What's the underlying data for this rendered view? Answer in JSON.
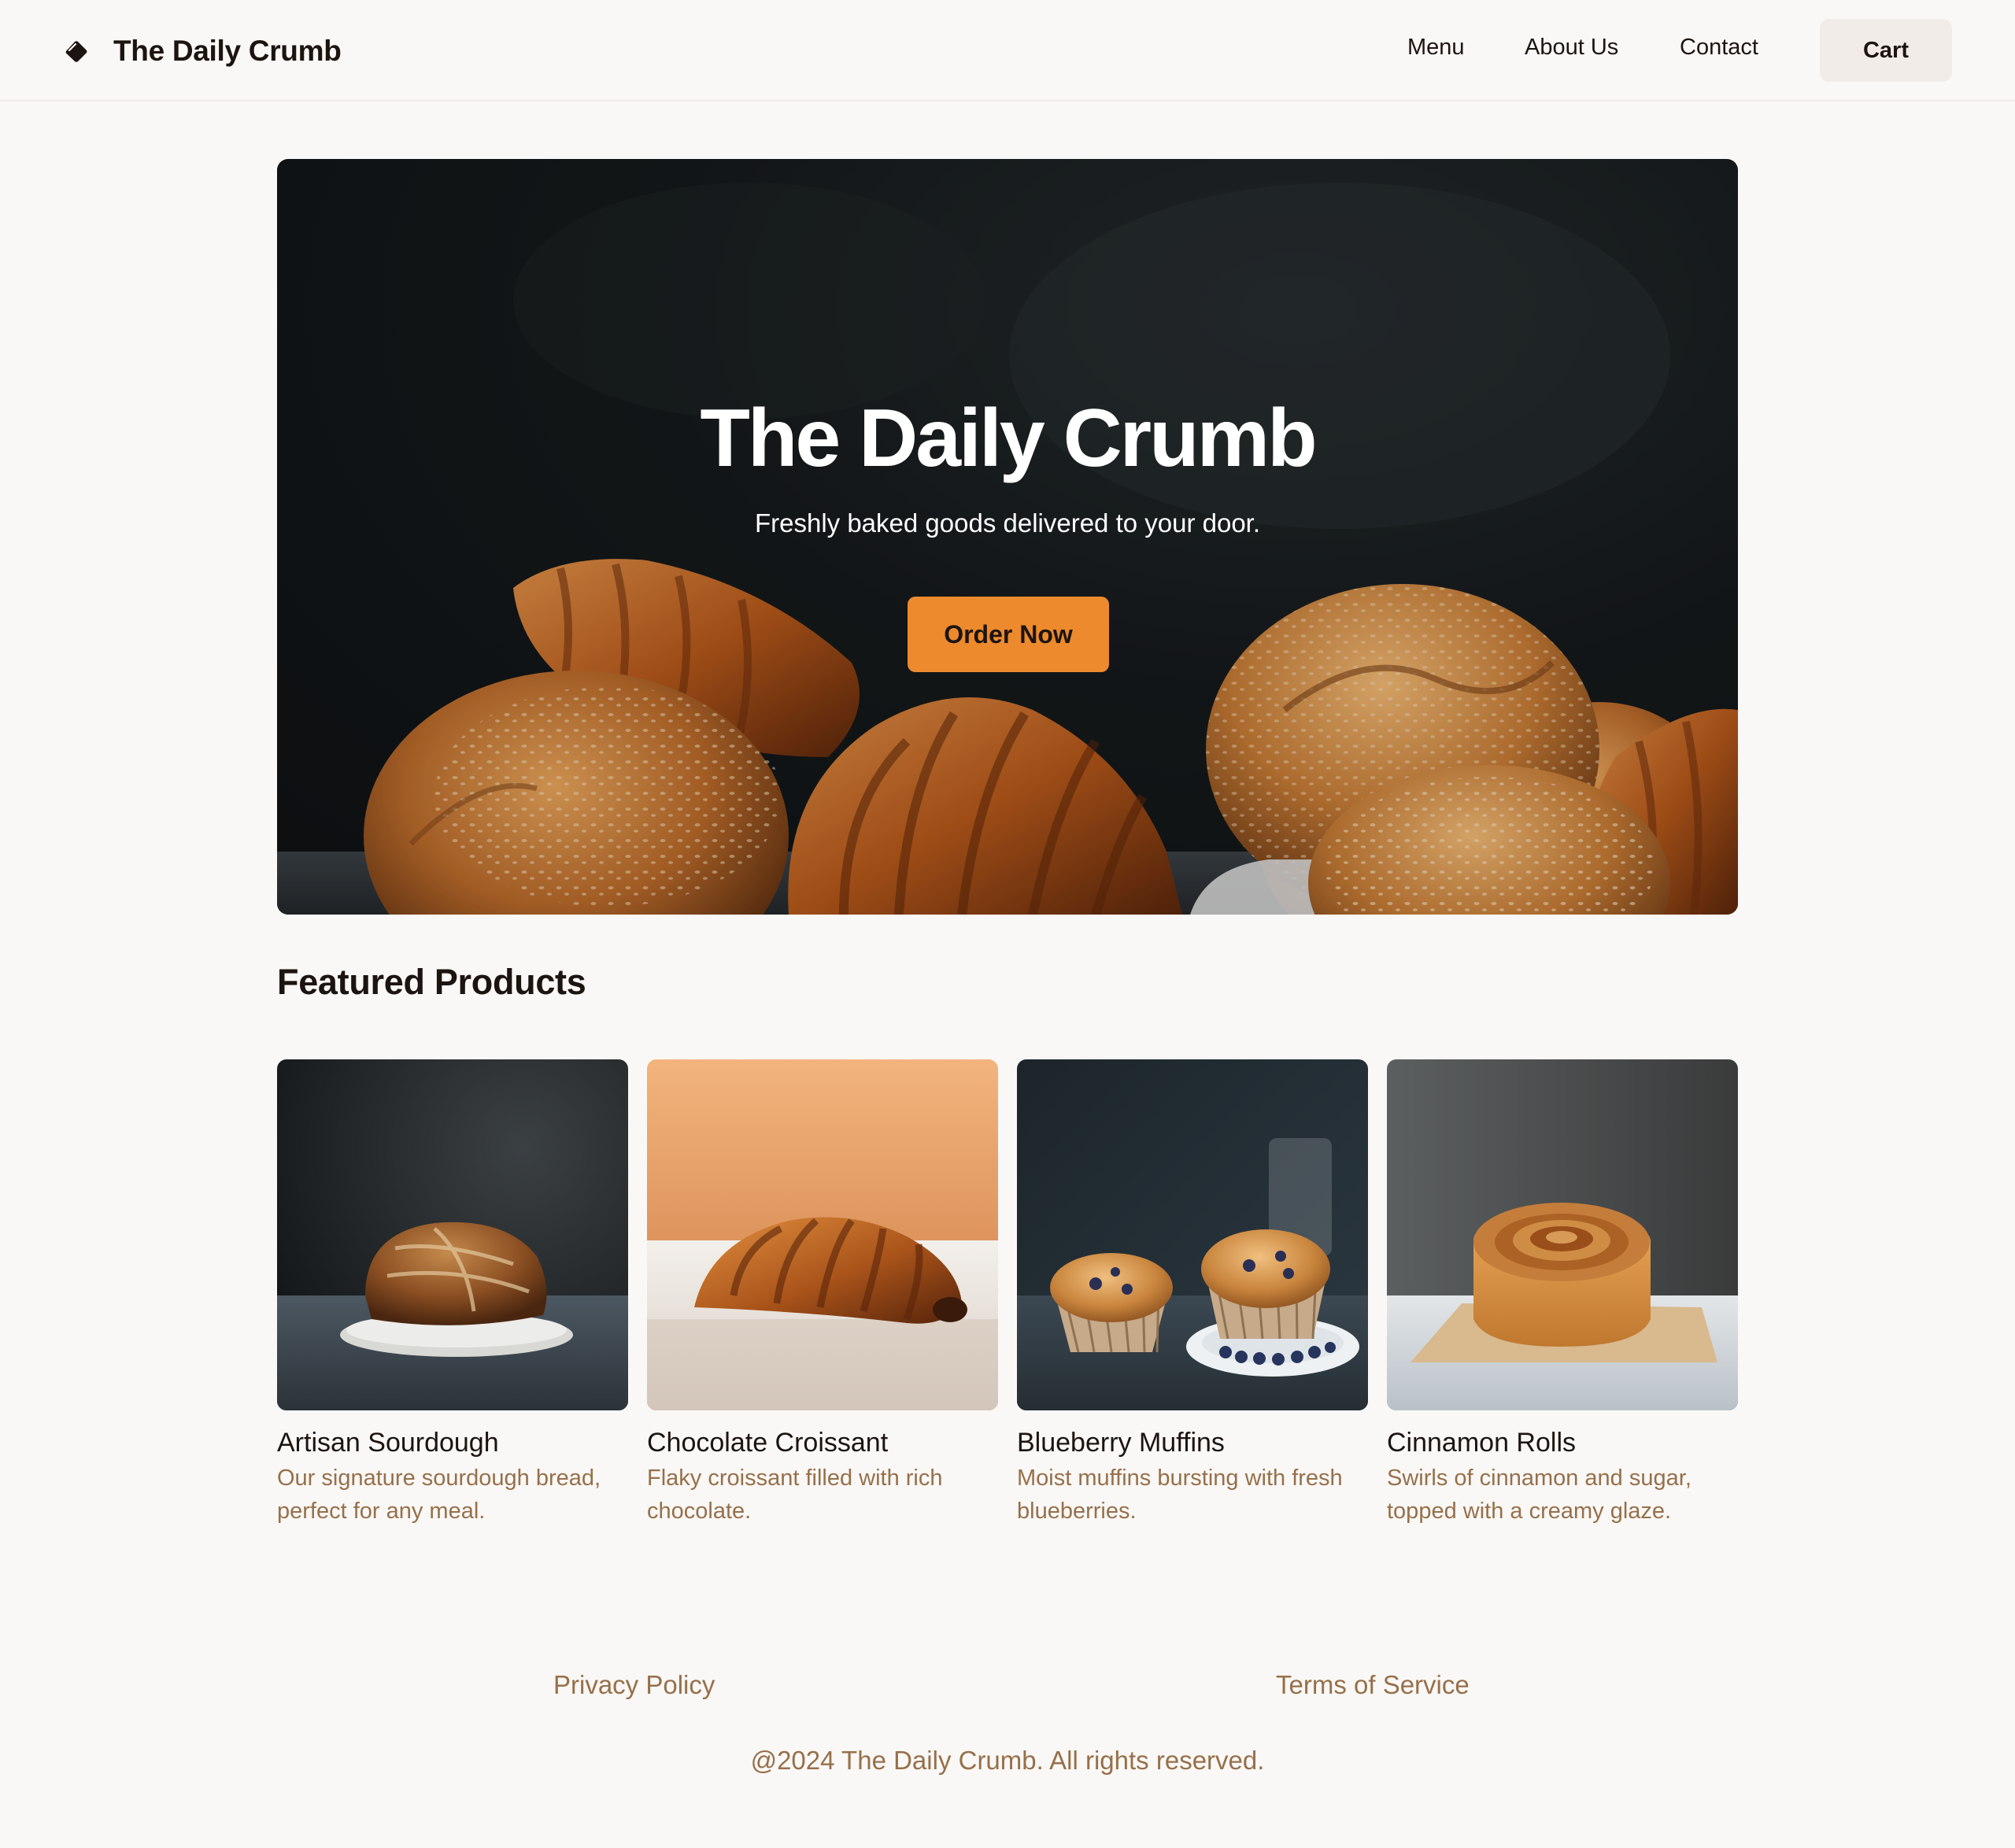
{
  "header": {
    "logo_icon": "bread-slice-icon",
    "brand": "The Daily Crumb",
    "nav": [
      "Menu",
      "About Us",
      "Contact"
    ],
    "cart_label": "Cart"
  },
  "hero": {
    "title": "The Daily Crumb",
    "subtitle": "Freshly baked goods delivered to your door.",
    "cta_label": "Order Now"
  },
  "featured": {
    "title": "Featured Products",
    "products": [
      {
        "name": "Artisan Sourdough",
        "description": "Our signature sourdough bread, perfect for any meal."
      },
      {
        "name": "Chocolate Croissant",
        "description": "Flaky croissant filled with rich chocolate."
      },
      {
        "name": "Blueberry Muffins",
        "description": "Moist muffins bursting with fresh blueberries."
      },
      {
        "name": "Cinnamon Rolls",
        "description": "Swirls of cinnamon and sugar, topped with a creamy glaze."
      }
    ]
  },
  "footer": {
    "links": [
      "Privacy Policy",
      "Terms of Service"
    ],
    "copyright": "@2024 The Daily Crumb. All rights reserved."
  },
  "colors": {
    "background": "#faf8f6",
    "accent": "#ec8a2d",
    "muted_text": "#96704b",
    "cart_bg": "#f1ece7"
  }
}
